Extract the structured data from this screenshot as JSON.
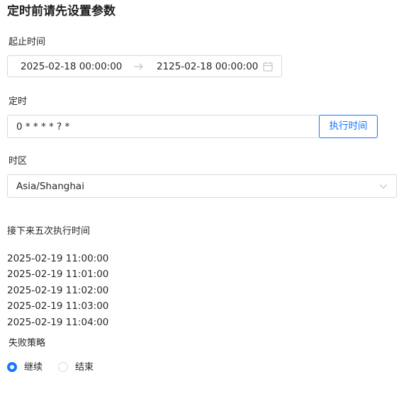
{
  "page": {
    "title": "定时前请先设置参数"
  },
  "range": {
    "label": "起止时间",
    "start": "2025-02-18 00:00:00",
    "end": "2125-02-18 00:00:00",
    "arrow_icon": "arrow-right-icon",
    "calendar_icon": "calendar-icon"
  },
  "cron": {
    "label": "定时",
    "value": "0 * * * * ? *",
    "button_label": "执行时间"
  },
  "timezone": {
    "label": "时区",
    "selected": "Asia/Shanghai",
    "dropdown_icon": "chevron-down-icon"
  },
  "next_runs": {
    "label": "接下来五次执行时间",
    "times": [
      "2025-02-19 11:00:00",
      "2025-02-19 11:01:00",
      "2025-02-19 11:02:00",
      "2025-02-19 11:03:00",
      "2025-02-19 11:04:00"
    ]
  },
  "failure_strategy": {
    "label": "失败策略",
    "options": [
      {
        "label": "继续",
        "checked": true
      },
      {
        "label": "结束",
        "checked": false
      }
    ]
  },
  "colors": {
    "primary": "#1677ff",
    "border": "#d9d9d9",
    "text": "#262626",
    "icon": "#bfbfbf"
  }
}
